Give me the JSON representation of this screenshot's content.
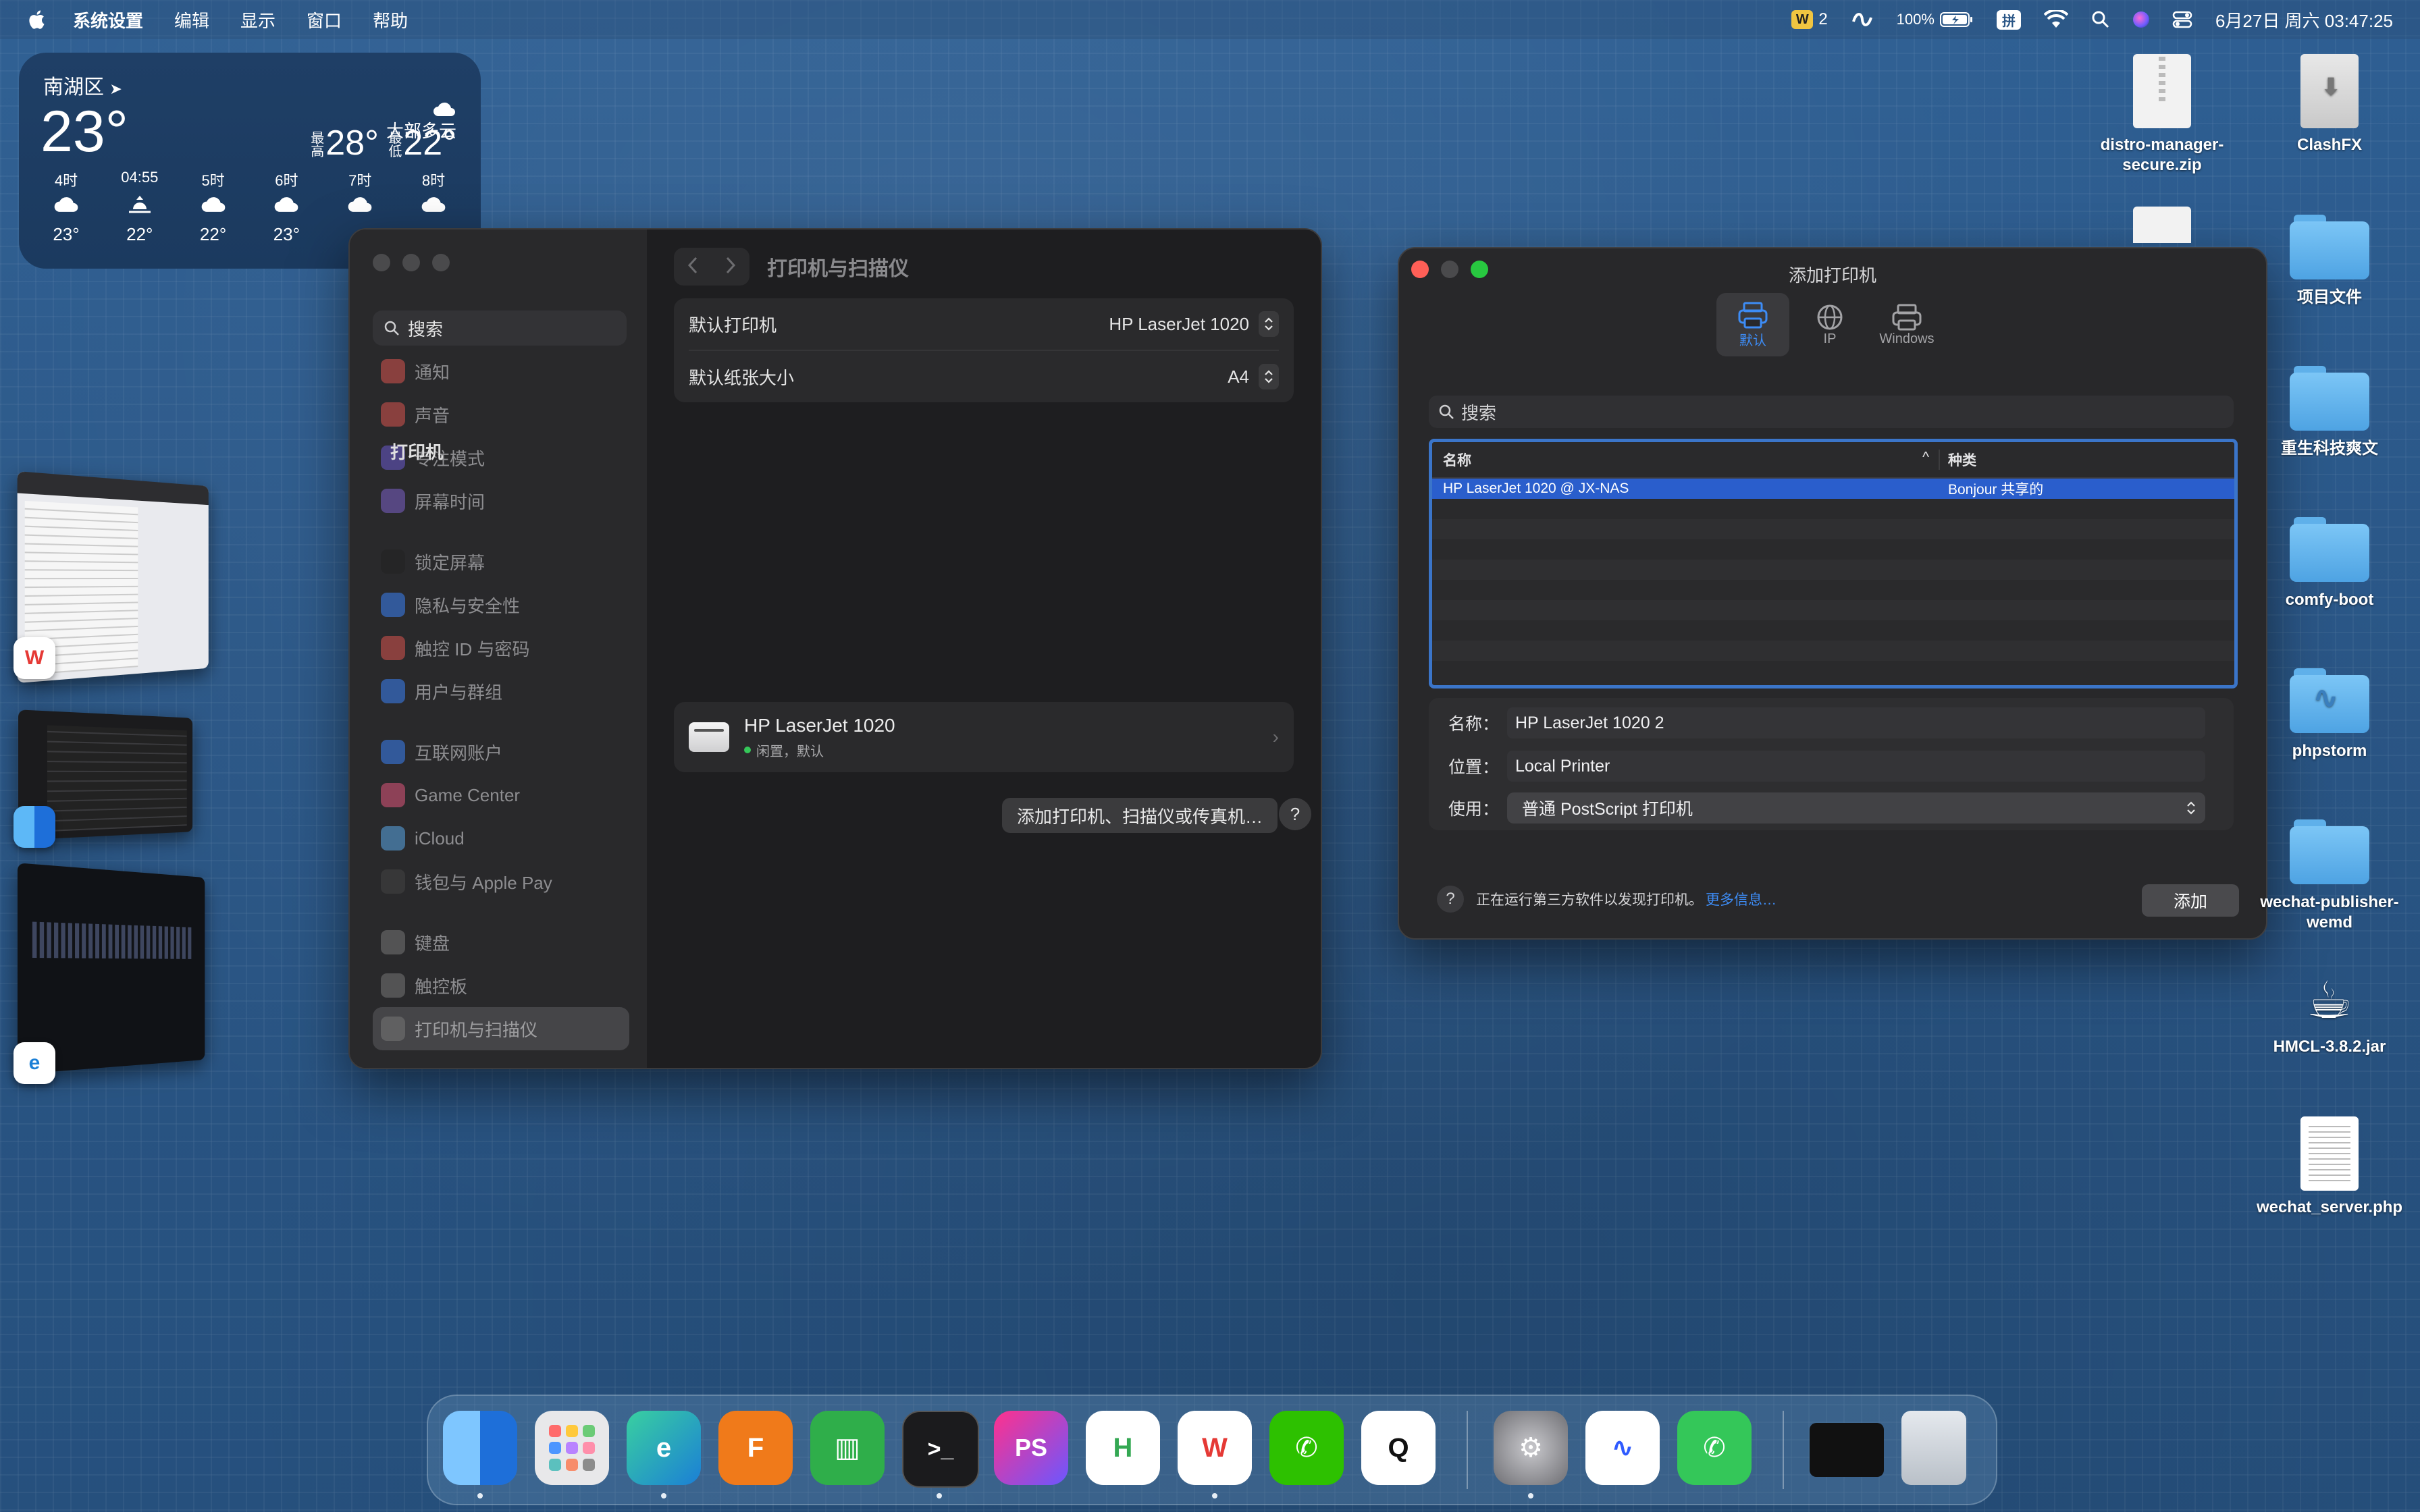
{
  "menubar": {
    "app": "系统设置",
    "items": [
      "编辑",
      "显示",
      "窗口",
      "帮助"
    ],
    "wps_badge": "2",
    "battery": "100%",
    "ime": "拼",
    "clock": "6月27日 周六 03:47:25"
  },
  "weather": {
    "location": "南湖区",
    "temp": "23°",
    "condition": "大部多云",
    "hi_label": "最高",
    "hi": "28°",
    "lo_label": "最低",
    "lo": "22°",
    "hours": [
      {
        "time": "4时",
        "icon": "cloud-icon",
        "temp": "23°"
      },
      {
        "time": "04:55",
        "icon": "sunrise-icon",
        "temp": "22°"
      },
      {
        "time": "5时",
        "icon": "cloud-icon",
        "temp": "22°"
      },
      {
        "time": "6时",
        "icon": "cloud-icon",
        "temp": "23°"
      },
      {
        "time": "7时",
        "icon": "cloud-icon",
        "temp": ""
      },
      {
        "time": "8时",
        "icon": "cloud-icon",
        "temp": ""
      }
    ]
  },
  "settings": {
    "title": "打印机与扫描仪",
    "search_placeholder": "搜索",
    "sidebar": [
      {
        "label": "通知",
        "color": "#d9534f"
      },
      {
        "label": "声音",
        "color": "#d9534f"
      },
      {
        "label": "专注模式",
        "color": "#6a5acd"
      },
      {
        "label": "屏幕时间",
        "color": "#7b61c9"
      },
      {
        "label": "锁定屏幕",
        "color": "#222222"
      },
      {
        "label": "隐私与安全性",
        "color": "#3b82f6"
      },
      {
        "label": "触控 ID 与密码",
        "color": "#d9534f"
      },
      {
        "label": "用户与群组",
        "color": "#3b82f6"
      },
      {
        "label": "互联网账户",
        "color": "#3b82f6"
      },
      {
        "label": "Game Center",
        "color": "#e0567c"
      },
      {
        "label": "iCloud",
        "color": "#5aa7e8"
      },
      {
        "label": "钱包与 Apple Pay",
        "color": "#444444"
      },
      {
        "label": "键盘",
        "color": "#777777"
      },
      {
        "label": "触控板",
        "color": "#777777"
      },
      {
        "label": "打印机与扫描仪",
        "color": "#777777"
      }
    ],
    "default_printer_label": "默认打印机",
    "default_printer_value": "HP LaserJet 1020",
    "paper_label": "默认纸张大小",
    "paper_value": "A4",
    "printers_heading": "打印机",
    "printer_name": "HP LaserJet 1020",
    "printer_status": "闲置，默认",
    "add_button": "添加打印机、扫描仪或传真机…",
    "help": "?"
  },
  "add_printer": {
    "title": "添加打印机",
    "tabs": [
      {
        "label": "默认",
        "icon": "printer-icon"
      },
      {
        "label": "IP",
        "icon": "globe-icon"
      },
      {
        "label": "Windows",
        "icon": "windows-printer-icon"
      }
    ],
    "search_placeholder": "搜索",
    "col_name": "名称",
    "col_kind": "种类",
    "rows": [
      {
        "name": "HP LaserJet 1020 @ JX-NAS",
        "kind": "Bonjour 共享的"
      }
    ],
    "name_label": "名称：",
    "name_value": "HP LaserJet 1020 2",
    "location_label": "位置：",
    "location_value": "Local Printer",
    "use_label": "使用：",
    "use_value": "普通 PostScript 打印机",
    "footer_text": "正在运行第三方软件以发现打印机。",
    "more_info": "更多信息…",
    "add_button": "添加",
    "help": "?"
  },
  "desktop": [
    {
      "label": "distro-manager-secure.zip",
      "type": "zip"
    },
    {
      "label": "ClashFX",
      "type": "dmg"
    },
    {
      "label": "项目文件",
      "type": "folder"
    },
    {
      "label": "重生科技爽文",
      "type": "folder"
    },
    {
      "label": "comfy-boot",
      "type": "folder"
    },
    {
      "label": "phpstorm",
      "type": "folder"
    },
    {
      "label": "wechat-publisher-wemd",
      "type": "folder"
    },
    {
      "label": "HMCL-3.8.2.jar",
      "type": "jar"
    },
    {
      "label": "wechat_server.php",
      "type": "doc"
    }
  ],
  "dock": {
    "apps": [
      {
        "name": "finder-icon",
        "glyph": "",
        "color": "#3b8ee8"
      },
      {
        "name": "launchpad-icon",
        "glyph": "",
        "color": "#e8e8ea"
      },
      {
        "name": "edge-icon",
        "glyph": "e",
        "color": "#1b7fd6"
      },
      {
        "name": "fusion-icon",
        "glyph": "F",
        "color": "#f07a1a"
      },
      {
        "name": "numbers-icon",
        "glyph": "▥",
        "color": "#2fae4a"
      },
      {
        "name": "terminal-icon",
        "glyph": ">_",
        "color": "#1b1b1d"
      },
      {
        "name": "phpstorm-icon",
        "glyph": "PS",
        "color": "#b3218a"
      },
      {
        "name": "hbuilder-icon",
        "glyph": "H",
        "color": "#34a853"
      },
      {
        "name": "wps-icon",
        "glyph": "W",
        "color": "#f4f4f4"
      },
      {
        "name": "wechat-icon",
        "glyph": "✆",
        "color": "#2dc100"
      },
      {
        "name": "qq-icon",
        "glyph": "Q",
        "color": "#f4f4f4"
      },
      {
        "name": "system-settings-icon",
        "glyph": "⚙",
        "color": "#8a8a8f"
      },
      {
        "name": "quark-icon",
        "glyph": "∿",
        "color": "#f4f4f4"
      },
      {
        "name": "phone-icon",
        "glyph": "✆",
        "color": "#34c759"
      },
      {
        "name": "terminal-window-icon",
        "glyph": "",
        "color": "#111111"
      },
      {
        "name": "trash-icon",
        "glyph": "",
        "color": "#d8dde2"
      }
    ]
  }
}
